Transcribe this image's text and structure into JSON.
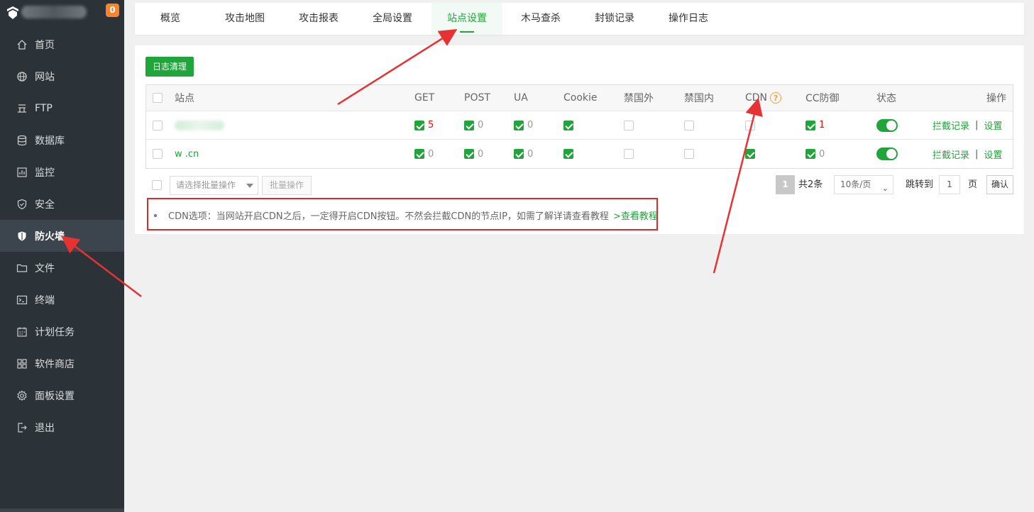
{
  "header": {
    "badge": "0"
  },
  "sidebar": {
    "items": [
      {
        "label": "首页",
        "icon": "home-icon"
      },
      {
        "label": "网站",
        "icon": "globe-icon"
      },
      {
        "label": "FTP",
        "icon": "ftp-icon"
      },
      {
        "label": "数据库",
        "icon": "database-icon"
      },
      {
        "label": "监控",
        "icon": "monitor-icon"
      },
      {
        "label": "安全",
        "icon": "shield-icon"
      },
      {
        "label": "防火墙",
        "icon": "firewall-icon",
        "active": true
      },
      {
        "label": "文件",
        "icon": "folder-icon"
      },
      {
        "label": "终端",
        "icon": "terminal-icon"
      },
      {
        "label": "计划任务",
        "icon": "calendar-icon"
      },
      {
        "label": "软件商店",
        "icon": "apps-icon"
      },
      {
        "label": "面板设置",
        "icon": "gear-icon"
      },
      {
        "label": "退出",
        "icon": "logout-icon"
      }
    ]
  },
  "tabs": [
    "概览",
    "攻击地图",
    "攻击报表",
    "全局设置",
    "站点设置",
    "木马查杀",
    "封锁记录",
    "操作日志"
  ],
  "active_tab": "站点设置",
  "toolbar": {
    "clear_log": "日志清理"
  },
  "table": {
    "headers": {
      "site": "站点",
      "get": "GET",
      "post": "POST",
      "ua": "UA",
      "cookie": "Cookie",
      "ban_foreign": "禁国外",
      "ban_domestic": "禁国内",
      "cdn": "CDN",
      "cc": "CC防御",
      "status": "状态",
      "actions": "操作"
    },
    "help_glyph": "?",
    "rows": [
      {
        "site": "",
        "get": "5",
        "post": "0",
        "ua": "0",
        "cookie": true,
        "ban_foreign": false,
        "ban_domestic": false,
        "cdn": false,
        "cc": "1",
        "status": true
      },
      {
        "site": "w            .cn",
        "get": "0",
        "post": "0",
        "ua": "0",
        "cookie": true,
        "ban_foreign": false,
        "ban_domestic": false,
        "cdn": true,
        "cc": "0",
        "status": true
      }
    ],
    "action_intercept": "拦截记录",
    "action_separator": "|",
    "action_settings": "设置"
  },
  "batch": {
    "select_placeholder": "请选择批量操作",
    "batch_button": "批量操作"
  },
  "pagination": {
    "current": "1",
    "total": "共2条",
    "per_page": "10条/页",
    "jump_label": "跳转到",
    "jump_value": "1",
    "page_label": "页",
    "confirm": "确认"
  },
  "note": {
    "text": "CDN选项：当网站开启CDN之后，一定得开启CDN按钮。不然会拦截CDN的节点IP，如需了解详请查看教程",
    "link": ">查看教程"
  },
  "colors": {
    "accent": "#20a53a",
    "sidebar_bg": "#3c444d",
    "badge": "#f7842f",
    "annotation": "#e02a2a"
  }
}
